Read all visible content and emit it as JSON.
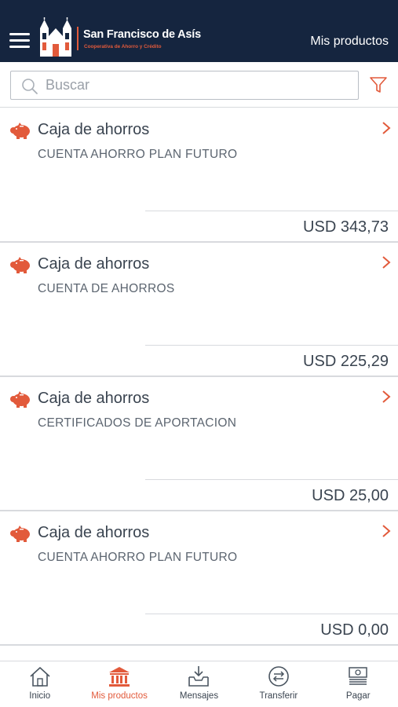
{
  "header": {
    "menu_icon": "hamburger-menu-icon",
    "logo_icon": "church-logo-icon",
    "brand_name": "San Francisco de Asís",
    "brand_subtitle": "Cooperativa de Ahorro y Crédito",
    "title": "Mis productos",
    "background_color": "#15253f",
    "accent_color": "#e25a3b"
  },
  "search": {
    "placeholder": "Buscar",
    "value": "",
    "search_icon": "magnifier-icon",
    "filter_icon": "funnel-filter-icon"
  },
  "products": [
    {
      "type": "Caja de ahorros",
      "name": "CUENTA AHORRO PLAN FUTURO",
      "amount": "USD 343,73",
      "icon": "piggy-bank-icon"
    },
    {
      "type": "Caja de ahorros",
      "name": "CUENTA DE AHORROS",
      "amount": "USD 225,29",
      "icon": "piggy-bank-icon"
    },
    {
      "type": "Caja de ahorros",
      "name": "CERTIFICADOS DE APORTACION",
      "amount": "USD 25,00",
      "icon": "piggy-bank-icon"
    },
    {
      "type": "Caja de ahorros",
      "name": "CUENTA AHORRO PLAN FUTURO",
      "amount": "USD 0,00",
      "icon": "piggy-bank-icon"
    }
  ],
  "bottom_nav": [
    {
      "label": "Inicio",
      "icon": "home-icon",
      "active": false
    },
    {
      "label": "Mis productos",
      "icon": "bank-building-icon",
      "active": true
    },
    {
      "label": "Mensajes",
      "icon": "inbox-download-icon",
      "active": false
    },
    {
      "label": "Transferir",
      "icon": "transfer-arrows-icon",
      "active": false
    },
    {
      "label": "Pagar",
      "icon": "money-stack-icon",
      "active": false
    }
  ]
}
